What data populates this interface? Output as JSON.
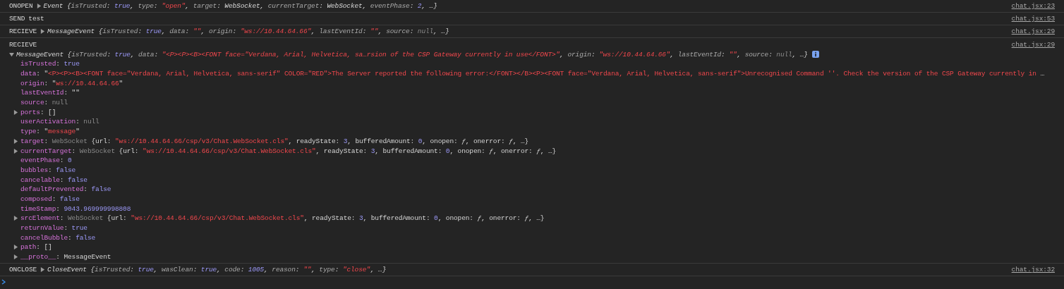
{
  "messages": [
    {
      "label": "ONOPEN",
      "kind": "object",
      "expanded": false,
      "source": "chat.jsx:23",
      "preview": [
        {
          "kind": "plain",
          "text": "Event {"
        },
        {
          "kind": "key",
          "text": "isTrusted"
        },
        {
          "kind": "plain",
          "text": ": "
        },
        {
          "kind": "literal",
          "text": "true"
        },
        {
          "kind": "plain",
          "text": ", "
        },
        {
          "kind": "key",
          "text": "type"
        },
        {
          "kind": "plain",
          "text": ": "
        },
        {
          "kind": "string",
          "text": "\"open\""
        },
        {
          "kind": "plain",
          "text": ", "
        },
        {
          "kind": "key",
          "text": "target"
        },
        {
          "kind": "plain",
          "text": ": WebSocket, "
        },
        {
          "kind": "key",
          "text": "currentTarget"
        },
        {
          "kind": "plain",
          "text": ": WebSocket, "
        },
        {
          "kind": "key",
          "text": "eventPhase"
        },
        {
          "kind": "plain",
          "text": ": "
        },
        {
          "kind": "literal",
          "text": "2"
        },
        {
          "kind": "plain",
          "text": ", …}"
        }
      ]
    },
    {
      "label": "SEND",
      "kind": "text",
      "source": "chat.jsx:53",
      "preview": [
        {
          "kind": "plain",
          "text": "test"
        }
      ]
    },
    {
      "label": "RECIEVE",
      "kind": "object",
      "expanded": false,
      "source": "chat.jsx:29",
      "preview": [
        {
          "kind": "plain",
          "text": "MessageEvent {"
        },
        {
          "kind": "key",
          "text": "isTrusted"
        },
        {
          "kind": "plain",
          "text": ": "
        },
        {
          "kind": "literal",
          "text": "true"
        },
        {
          "kind": "plain",
          "text": ", "
        },
        {
          "kind": "key",
          "text": "data"
        },
        {
          "kind": "plain",
          "text": ": "
        },
        {
          "kind": "string",
          "text": "\"\""
        },
        {
          "kind": "plain",
          "text": ", "
        },
        {
          "kind": "key",
          "text": "origin"
        },
        {
          "kind": "plain",
          "text": ": "
        },
        {
          "kind": "string",
          "text": "\"ws://10.44.64.66\""
        },
        {
          "kind": "plain",
          "text": ", "
        },
        {
          "kind": "key",
          "text": "lastEventId"
        },
        {
          "kind": "plain",
          "text": ": "
        },
        {
          "kind": "string",
          "text": "\"\""
        },
        {
          "kind": "plain",
          "text": ", "
        },
        {
          "kind": "key",
          "text": "source"
        },
        {
          "kind": "plain",
          "text": ": "
        },
        {
          "kind": "null",
          "text": "null"
        },
        {
          "kind": "plain",
          "text": ", …}"
        }
      ]
    },
    {
      "label": "RECIEVE",
      "kind": "object",
      "expanded": true,
      "source": "chat.jsx:29",
      "preview": [
        {
          "kind": "plain",
          "text": "MessageEvent {"
        },
        {
          "kind": "key",
          "text": "isTrusted"
        },
        {
          "kind": "plain",
          "text": ": "
        },
        {
          "kind": "literal",
          "text": "true"
        },
        {
          "kind": "plain",
          "text": ", "
        },
        {
          "kind": "key",
          "text": "data"
        },
        {
          "kind": "plain",
          "text": ": "
        },
        {
          "kind": "string",
          "text": "\"<P><P><B><FONT face=\"Verdana, Arial, Helvetica, sa…rsion of the CSP Gateway currently in use</FONT>\""
        },
        {
          "kind": "plain",
          "text": ", "
        },
        {
          "kind": "key",
          "text": "origin"
        },
        {
          "kind": "plain",
          "text": ": "
        },
        {
          "kind": "string",
          "text": "\"ws://10.44.64.66\""
        },
        {
          "kind": "plain",
          "text": ", "
        },
        {
          "kind": "key",
          "text": "lastEventId"
        },
        {
          "kind": "plain",
          "text": ": "
        },
        {
          "kind": "string",
          "text": "\"\""
        },
        {
          "kind": "plain",
          "text": ", "
        },
        {
          "kind": "key",
          "text": "source"
        },
        {
          "kind": "plain",
          "text": ": "
        },
        {
          "kind": "null",
          "text": "null"
        },
        {
          "kind": "plain",
          "text": ", …}"
        }
      ],
      "properties": [
        {
          "name": "isTrusted",
          "expandable": false,
          "value": [
            {
              "kind": "plain",
              "text": ": "
            },
            {
              "kind": "literal",
              "text": "true"
            }
          ]
        },
        {
          "name": "data",
          "expandable": false,
          "value": [
            {
              "kind": "plain",
              "text": ": \""
            },
            {
              "kind": "string",
              "text": "<P><P><B><FONT face=\"Verdana, Arial, Helvetica, sans-serif\" COLOR=\"RED\">The Server reported the following error:</FONT></B><P><FONT face=\"Verdana, Arial, Helvetica, sans-serif\">Unrecognised Command ''. Check the version of the CSP Gateway currently in"
            },
            {
              "kind": "plain",
              "text": " …"
            }
          ]
        },
        {
          "name": "origin",
          "expandable": false,
          "value": [
            {
              "kind": "plain",
              "text": ": \""
            },
            {
              "kind": "string",
              "text": "ws://10.44.64.66"
            },
            {
              "kind": "plain",
              "text": "\""
            }
          ]
        },
        {
          "name": "lastEventId",
          "expandable": false,
          "value": [
            {
              "kind": "plain",
              "text": ": \"\""
            }
          ]
        },
        {
          "name": "source",
          "expandable": false,
          "value": [
            {
              "kind": "plain",
              "text": ": "
            },
            {
              "kind": "null",
              "text": "null"
            }
          ]
        },
        {
          "name": "ports",
          "expandable": true,
          "value": [
            {
              "kind": "plain",
              "text": ": []"
            }
          ]
        },
        {
          "name": "userActivation",
          "expandable": false,
          "value": [
            {
              "kind": "plain",
              "text": ": "
            },
            {
              "kind": "null",
              "text": "null"
            }
          ]
        },
        {
          "name": "type",
          "expandable": false,
          "value": [
            {
              "kind": "plain",
              "text": ": \""
            },
            {
              "kind": "string",
              "text": "message"
            },
            {
              "kind": "plain",
              "text": "\""
            }
          ]
        },
        {
          "name": "target",
          "expandable": true,
          "value": [
            {
              "kind": "plain",
              "text": ": "
            },
            {
              "kind": "null",
              "text": "WebSocket"
            },
            {
              "kind": "plain",
              "text": " {url: "
            },
            {
              "kind": "string",
              "text": "\"ws://10.44.64.66/csp/v3/Chat.WebSocket.cls\""
            },
            {
              "kind": "plain",
              "text": ", readyState: "
            },
            {
              "kind": "literal",
              "text": "3"
            },
            {
              "kind": "plain",
              "text": ", bufferedAmount: "
            },
            {
              "kind": "literal",
              "text": "0"
            },
            {
              "kind": "plain",
              "text": ", onopen: "
            },
            {
              "kind": "italic",
              "text": "ƒ"
            },
            {
              "kind": "plain",
              "text": ", onerror: "
            },
            {
              "kind": "italic",
              "text": "ƒ"
            },
            {
              "kind": "plain",
              "text": ", …}"
            }
          ]
        },
        {
          "name": "currentTarget",
          "expandable": true,
          "value": [
            {
              "kind": "plain",
              "text": ": "
            },
            {
              "kind": "null",
              "text": "WebSocket"
            },
            {
              "kind": "plain",
              "text": " {url: "
            },
            {
              "kind": "string",
              "text": "\"ws://10.44.64.66/csp/v3/Chat.WebSocket.cls\""
            },
            {
              "kind": "plain",
              "text": ", readyState: "
            },
            {
              "kind": "literal",
              "text": "3"
            },
            {
              "kind": "plain",
              "text": ", bufferedAmount: "
            },
            {
              "kind": "literal",
              "text": "0"
            },
            {
              "kind": "plain",
              "text": ", onopen: "
            },
            {
              "kind": "italic",
              "text": "ƒ"
            },
            {
              "kind": "plain",
              "text": ", onerror: "
            },
            {
              "kind": "italic",
              "text": "ƒ"
            },
            {
              "kind": "plain",
              "text": ", …}"
            }
          ]
        },
        {
          "name": "eventPhase",
          "expandable": false,
          "value": [
            {
              "kind": "plain",
              "text": ": "
            },
            {
              "kind": "literal",
              "text": "0"
            }
          ]
        },
        {
          "name": "bubbles",
          "expandable": false,
          "value": [
            {
              "kind": "plain",
              "text": ": "
            },
            {
              "kind": "literal",
              "text": "false"
            }
          ]
        },
        {
          "name": "cancelable",
          "expandable": false,
          "value": [
            {
              "kind": "plain",
              "text": ": "
            },
            {
              "kind": "literal",
              "text": "false"
            }
          ]
        },
        {
          "name": "defaultPrevented",
          "expandable": false,
          "value": [
            {
              "kind": "plain",
              "text": ": "
            },
            {
              "kind": "literal",
              "text": "false"
            }
          ]
        },
        {
          "name": "composed",
          "expandable": false,
          "value": [
            {
              "kind": "plain",
              "text": ": "
            },
            {
              "kind": "literal",
              "text": "false"
            }
          ]
        },
        {
          "name": "timeStamp",
          "expandable": false,
          "value": [
            {
              "kind": "plain",
              "text": ": "
            },
            {
              "kind": "literal",
              "text": "9043.969999998808"
            }
          ]
        },
        {
          "name": "srcElement",
          "expandable": true,
          "value": [
            {
              "kind": "plain",
              "text": ": "
            },
            {
              "kind": "null",
              "text": "WebSocket"
            },
            {
              "kind": "plain",
              "text": " {url: "
            },
            {
              "kind": "string",
              "text": "\"ws://10.44.64.66/csp/v3/Chat.WebSocket.cls\""
            },
            {
              "kind": "plain",
              "text": ", readyState: "
            },
            {
              "kind": "literal",
              "text": "3"
            },
            {
              "kind": "plain",
              "text": ", bufferedAmount: "
            },
            {
              "kind": "literal",
              "text": "0"
            },
            {
              "kind": "plain",
              "text": ", onopen: "
            },
            {
              "kind": "italic",
              "text": "ƒ"
            },
            {
              "kind": "plain",
              "text": ", onerror: "
            },
            {
              "kind": "italic",
              "text": "ƒ"
            },
            {
              "kind": "plain",
              "text": ", …}"
            }
          ]
        },
        {
          "name": "returnValue",
          "expandable": false,
          "value": [
            {
              "kind": "plain",
              "text": ": "
            },
            {
              "kind": "literal",
              "text": "true"
            }
          ]
        },
        {
          "name": "cancelBubble",
          "expandable": false,
          "value": [
            {
              "kind": "plain",
              "text": ": "
            },
            {
              "kind": "literal",
              "text": "false"
            }
          ]
        },
        {
          "name": "path",
          "expandable": true,
          "value": [
            {
              "kind": "plain",
              "text": ": []"
            }
          ]
        },
        {
          "name": "__proto__",
          "expandable": true,
          "value": [
            {
              "kind": "plain",
              "text": ": MessageEvent"
            }
          ]
        }
      ]
    },
    {
      "label": "ONCLOSE",
      "kind": "object",
      "expanded": false,
      "source": "chat.jsx:32",
      "preview": [
        {
          "kind": "plain",
          "text": "CloseEvent {"
        },
        {
          "kind": "key",
          "text": "isTrusted"
        },
        {
          "kind": "plain",
          "text": ": "
        },
        {
          "kind": "literal",
          "text": "true"
        },
        {
          "kind": "plain",
          "text": ", "
        },
        {
          "kind": "key",
          "text": "wasClean"
        },
        {
          "kind": "plain",
          "text": ": "
        },
        {
          "kind": "literal",
          "text": "true"
        },
        {
          "kind": "plain",
          "text": ", "
        },
        {
          "kind": "key",
          "text": "code"
        },
        {
          "kind": "plain",
          "text": ": "
        },
        {
          "kind": "literal",
          "text": "1005"
        },
        {
          "kind": "plain",
          "text": ", "
        },
        {
          "kind": "key",
          "text": "reason"
        },
        {
          "kind": "plain",
          "text": ": "
        },
        {
          "kind": "string",
          "text": "\"\""
        },
        {
          "kind": "plain",
          "text": ", "
        },
        {
          "kind": "key",
          "text": "type"
        },
        {
          "kind": "plain",
          "text": ": "
        },
        {
          "kind": "string",
          "text": "\"close\""
        },
        {
          "kind": "plain",
          "text": ", …}"
        }
      ]
    }
  ]
}
